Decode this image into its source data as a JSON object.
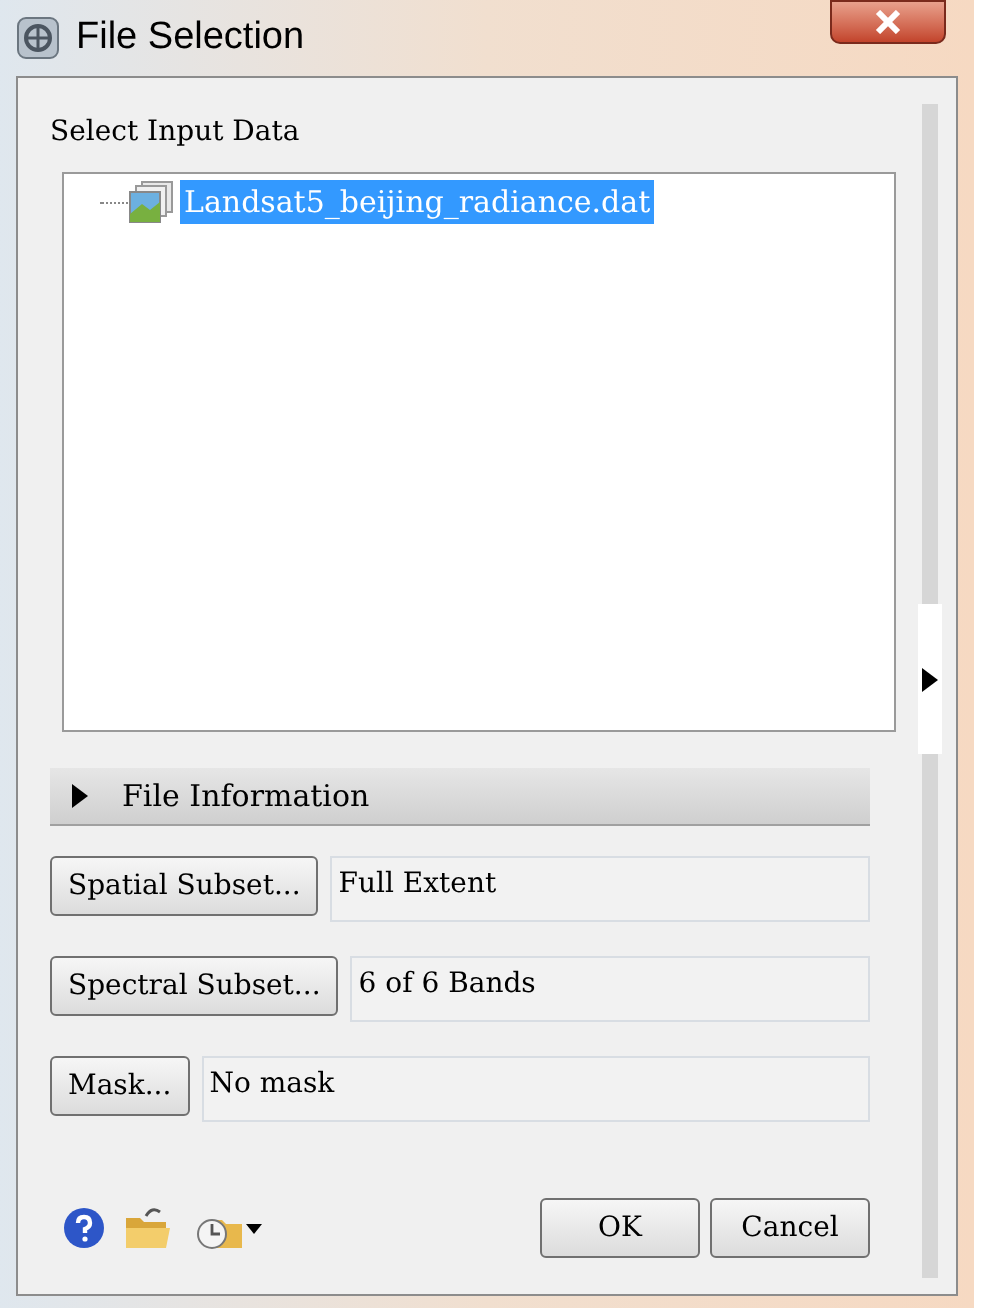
{
  "window": {
    "title": "File Selection"
  },
  "section_label": "Select Input Data",
  "files": [
    {
      "label": "Landsat5_beijing_radiance.dat",
      "selected": true
    }
  ],
  "file_information": {
    "label": "File Information",
    "expanded": false
  },
  "subset_rows": [
    {
      "button": "Spatial Subset...",
      "value": "Full Extent"
    },
    {
      "button": "Spectral Subset...",
      "value": "6 of 6 Bands"
    },
    {
      "button": "Mask...",
      "value": "No mask"
    }
  ],
  "buttons": [
    "OK",
    "Cancel"
  ]
}
